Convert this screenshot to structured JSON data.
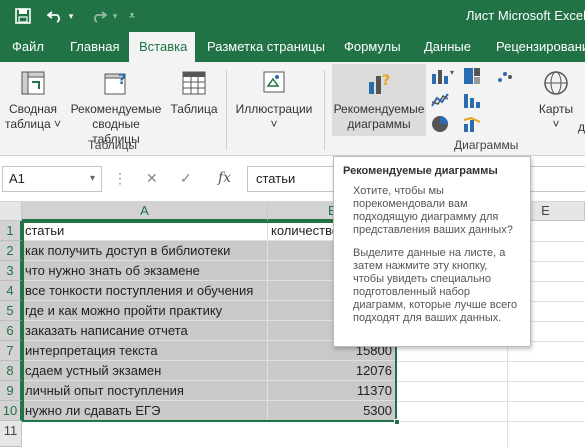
{
  "app": {
    "window_title": "Лист Microsoft Excel ия"
  },
  "qat": {
    "save_icon": "save-icon",
    "undo_icon": "undo-icon",
    "redo_icon": "redo-icon",
    "customize_icon": "customize-qat-icon"
  },
  "tabs": [
    {
      "label": "Файл",
      "active": false
    },
    {
      "label": "Главная",
      "active": false
    },
    {
      "label": "Вставка",
      "active": true
    },
    {
      "label": "Разметка страницы",
      "active": false
    },
    {
      "label": "Формулы",
      "active": false
    },
    {
      "label": "Данные",
      "active": false
    },
    {
      "label": "Рецензирование",
      "active": false
    }
  ],
  "ribbon": {
    "pivot_line1": "Сводная",
    "pivot_line2": "таблица ˅",
    "rec_pivot_line1": "Рекомендуемые",
    "rec_pivot_line2": "сводные таблицы",
    "table_label": "Таблица",
    "tables_group": "Таблицы",
    "illustrations_label": "Иллюстрации",
    "illustrations_caret": "˅",
    "rec_charts_line1": "Рекомендуемые",
    "rec_charts_line2": "диаграммы",
    "maps_label": "Карты",
    "maps_caret": "˅",
    "charts_group": "Диаграммы",
    "truncated_char": "д"
  },
  "formula_bar": {
    "name_box": "A1",
    "formula": "статьи",
    "fx_label": "fx"
  },
  "columns": [
    "A",
    "B",
    "E"
  ],
  "rows": [
    {
      "num": "1",
      "a": "статьи",
      "b": "количество"
    },
    {
      "num": "2",
      "a": "как получить доступ в библиотеки",
      "b": ""
    },
    {
      "num": "3",
      "a": "что нужно знать об экзамене",
      "b": ""
    },
    {
      "num": "4",
      "a": "все тонкости поступления и обучения",
      "b": ""
    },
    {
      "num": "5",
      "a": "где и как можно пройти практику",
      "b": ""
    },
    {
      "num": "6",
      "a": "заказать написание отчета",
      "b": ""
    },
    {
      "num": "7",
      "a": "интерпретация текста",
      "b": "15800"
    },
    {
      "num": "8",
      "a": "сдаем устный экзамен",
      "b": "12076"
    },
    {
      "num": "9",
      "a": "личный опыт поступления",
      "b": "11370"
    },
    {
      "num": "10",
      "a": "нужно ли сдавать ЕГЭ",
      "b": "5300"
    },
    {
      "num": "11",
      "a": "",
      "b": ""
    }
  ],
  "tooltip": {
    "title": "Рекомендуемые диаграммы",
    "p1": "Хотите, чтобы мы порекомендовали вам подходящую диаграмму для представления ваших данных?",
    "p2": "Выделите данные на листе, а затем нажмите эту кнопку, чтобы увидеть специально подготовленный набор диаграмм, которые лучше всего подходят для ваших данных."
  },
  "colors": {
    "excel_green": "#217346",
    "ribbon_bg": "#f3f3f3",
    "selection_gray": "#c9c9c9"
  }
}
